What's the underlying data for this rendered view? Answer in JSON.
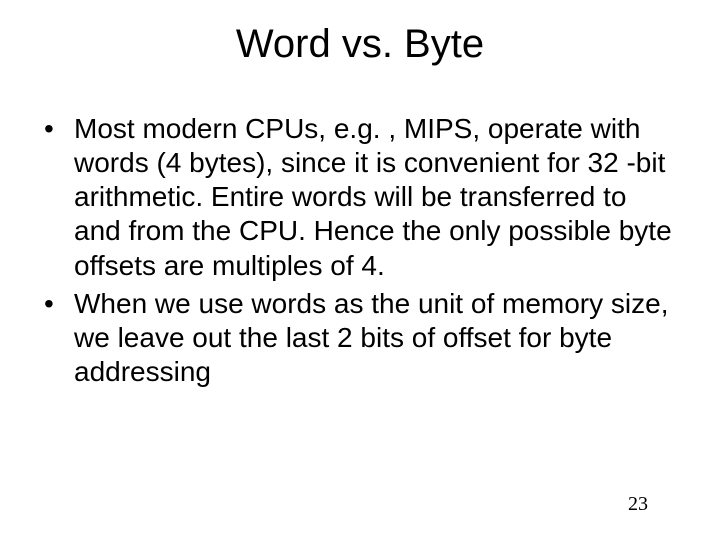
{
  "slide": {
    "title": "Word vs. Byte",
    "bullets": [
      "Most modern CPUs, e.g. , MIPS, operate with words (4 bytes), since it is convenient for 32 -bit arithmetic. Entire words will be transferred to and from the CPU. Hence the only possible byte offsets are multiples of 4.",
      "When we use words as the unit of memory size, we leave out the last 2 bits of offset for byte addressing"
    ],
    "page_number": "23"
  }
}
